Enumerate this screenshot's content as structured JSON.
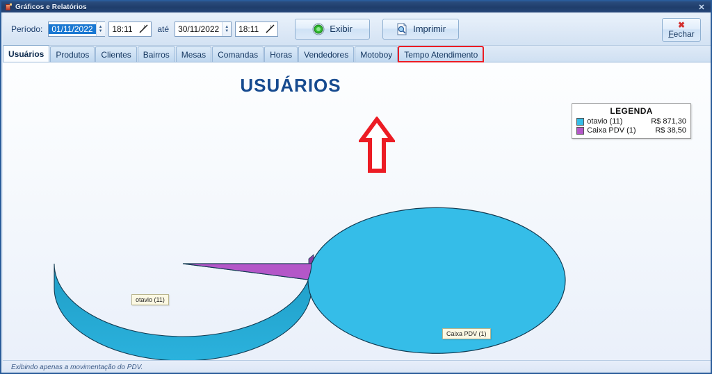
{
  "window": {
    "title": "Gráficos e Relatórios",
    "icon": "report-icon",
    "close_glyph": "✕"
  },
  "toolbar": {
    "period_label": "Período:",
    "date_from": "01/11/2022",
    "time_from": "18:11",
    "between_label": "até",
    "date_to": "30/11/2022",
    "time_to": "18:11",
    "show_button": "Exibir",
    "print_button": "Imprimir",
    "close_button_x": "✖",
    "close_button_label_pre": "F",
    "close_button_label_rest": "echar"
  },
  "tabs": [
    {
      "label": "Usuários",
      "active": true,
      "highlighted": false
    },
    {
      "label": "Produtos",
      "active": false,
      "highlighted": false
    },
    {
      "label": "Clientes",
      "active": false,
      "highlighted": false
    },
    {
      "label": "Bairros",
      "active": false,
      "highlighted": false
    },
    {
      "label": "Mesas",
      "active": false,
      "highlighted": false
    },
    {
      "label": "Comandas",
      "active": false,
      "highlighted": false
    },
    {
      "label": "Horas",
      "active": false,
      "highlighted": false
    },
    {
      "label": "Vendedores",
      "active": false,
      "highlighted": false
    },
    {
      "label": "Motoboy",
      "active": false,
      "highlighted": false
    },
    {
      "label": "Tempo Atendimento",
      "active": false,
      "highlighted": true
    }
  ],
  "chart_data": {
    "type": "pie",
    "title": "USUÁRIOS",
    "xlabel": "",
    "ylabel": "",
    "legend_title": "LEGENDA",
    "legend_position": "top-right",
    "grid": false,
    "categories": [
      "otavio (11)",
      "Caixa PDV (1)"
    ],
    "values": [
      871.3,
      38.5
    ],
    "value_labels": [
      "R$ 871,30",
      "R$ 38,50"
    ],
    "counts": [
      11,
      1
    ],
    "percentages": [
      95.8,
      4.2
    ],
    "colors": [
      "#35bde8",
      "#b457c8"
    ],
    "slice_labels": [
      "otavio (11)",
      "Caixa PDV (1)"
    ],
    "three_d": true
  },
  "annotation": {
    "arrow": "red-up-arrow",
    "arrow_color": "#ec1c24",
    "highlight_color": "#ec1c24"
  },
  "statusbar": {
    "text": "Exibindo apenas a movimentação do PDV."
  },
  "colors": {
    "title_accent": "#164a8f",
    "window_border": "#2a5c9a",
    "slice_primary": "#35bde8",
    "slice_secondary": "#b457c8",
    "selection_blue": "#1a78d2"
  }
}
